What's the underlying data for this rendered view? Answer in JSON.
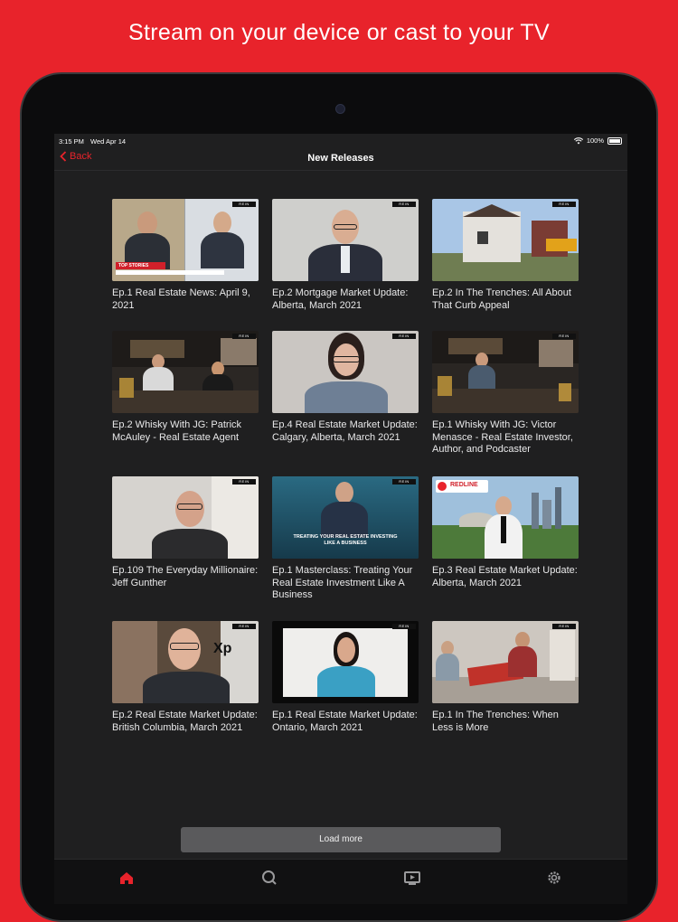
{
  "headline": "Stream on your device or cast to your TV",
  "status": {
    "time": "3:15 PM",
    "date": "Wed Apr 14",
    "battery": "100%"
  },
  "nav": {
    "back_label": "Back",
    "title": "New Releases"
  },
  "episodes": [
    {
      "title": "Ep.1 Real Estate News: April 9, 2021"
    },
    {
      "title": "Ep.2 Mortgage Market Update: Alberta, March 2021"
    },
    {
      "title": "Ep.2 In The Trenches: All About That Curb Appeal"
    },
    {
      "title": "Ep.2 Whisky With JG: Patrick McAuley - Real Estate Agent"
    },
    {
      "title": "Ep.4 Real Estate Market Update: Calgary, Alberta, March 2021"
    },
    {
      "title": "Ep.1 Whisky With JG: Victor Menasce - Real Estate Investor, Author, and Podcaster"
    },
    {
      "title": "Ep.109 The Everyday Millionaire: Jeff Gunther"
    },
    {
      "title": "Ep.1 Masterclass: Treating Your Real Estate Investment Like A Business"
    },
    {
      "title": "Ep.3 Real Estate Market Update: Alberta, March 2021"
    },
    {
      "title": "Ep.2 Real Estate Market Update: British Columbia, March 2021"
    },
    {
      "title": "Ep.1 Real Estate Market Update: Ontario, March 2021"
    },
    {
      "title": "Ep.1 In The Trenches: When Less is More"
    }
  ],
  "thumb_text": {
    "top_stories": "TOP STORIES",
    "masterclass": "TREATING YOUR REAL ESTATE INVESTING LIKE A BUSINESS",
    "redline": "REDLINE",
    "xp": "Xp"
  },
  "load_more_label": "Load more",
  "tabs": [
    {
      "icon": "home-icon",
      "active": true
    },
    {
      "icon": "search-icon",
      "active": false
    },
    {
      "icon": "video-icon",
      "active": false
    },
    {
      "icon": "gear-icon",
      "active": false
    }
  ],
  "colors": {
    "accent": "#e8232b",
    "background": "#1f1f20"
  }
}
